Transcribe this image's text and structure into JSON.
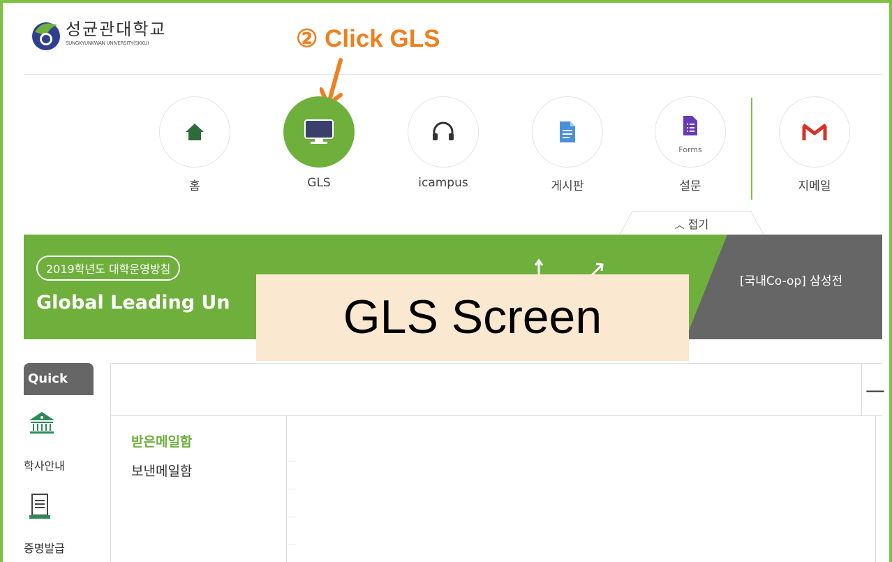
{
  "logo": {
    "korean": "성균관대학교",
    "english": "SUNGKYUNKWAN UNIVERSITY(SKKU)"
  },
  "annotation": {
    "text": "② Click GLS",
    "color": "#f07f1e"
  },
  "nav": {
    "items": [
      {
        "label": "홈",
        "icon": "home-icon"
      },
      {
        "label": "GLS",
        "icon": "monitor-icon",
        "active": true
      },
      {
        "label": "icampus",
        "icon": "headset-icon"
      },
      {
        "label": "게시판",
        "icon": "document-icon"
      },
      {
        "label": "설문",
        "icon": "forms-icon",
        "sublabel": "Forms"
      },
      {
        "label": "지메일",
        "icon": "gmail-icon"
      }
    ],
    "fold_label": "접기",
    "accent": "#6eb03b"
  },
  "banner": {
    "pill": "2019학년도 대학운영방침",
    "title": "Global Leading Un",
    "notice": "[국내Co-op] 삼성전"
  },
  "overlay": {
    "text": "GLS Screen",
    "background": "#fbe8d0"
  },
  "quick": {
    "title": "Quick",
    "items": [
      {
        "label": "학사안내",
        "icon": "bank-icon"
      },
      {
        "label": "증명발급",
        "icon": "certificate-icon"
      }
    ]
  },
  "mail": {
    "inbox": "받은메일함",
    "sent": "보낸메일함"
  }
}
